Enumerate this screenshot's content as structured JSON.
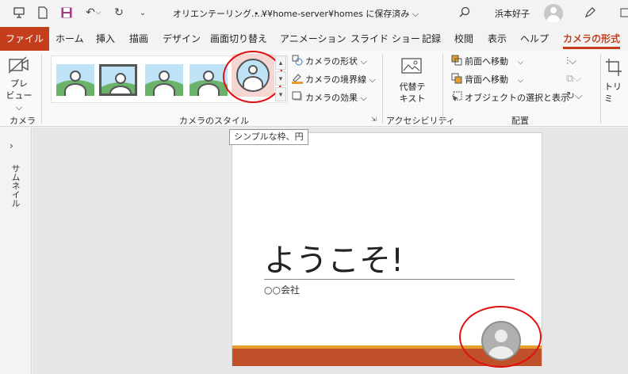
{
  "qat": {
    "doc_title": "オリエンテーリング.…",
    "save_status": "• ¥¥home-server¥homes に保存済み ⌵",
    "user_name": "浜本好子"
  },
  "tabs": [
    {
      "label": "ファイル"
    },
    {
      "label": "ホーム"
    },
    {
      "label": "挿入"
    },
    {
      "label": "描画"
    },
    {
      "label": "デザイン"
    },
    {
      "label": "画面切り替え"
    },
    {
      "label": "アニメーション"
    },
    {
      "label": "スライド ショー"
    },
    {
      "label": "記録"
    },
    {
      "label": "校閲"
    },
    {
      "label": "表示"
    },
    {
      "label": "ヘルプ"
    },
    {
      "label": "カメラの形式"
    }
  ],
  "ribbon": {
    "camera_group": {
      "preview_label": "プレ",
      "preview_label2": "ビュー ⌵",
      "group_label": "カメラ"
    },
    "style_group": {
      "group_label": "カメラのスタイル",
      "shape_label": "カメラの形状 ⌵",
      "border_label": "カメラの境界線 ⌵",
      "effect_label": "カメラの効果 ⌵"
    },
    "accessibility_group": {
      "alt_label1": "代替テ",
      "alt_label2": "キスト",
      "group_label": "アクセシビリティ"
    },
    "arrange_group": {
      "forward_label": "前面へ移動",
      "backward_label": "背面へ移動",
      "selection_label": "オブジェクトの選択と表示",
      "group_label": "配置"
    },
    "trim_label": "トリミ"
  },
  "tooltip": "シンプルな枠、円",
  "sidebar": {
    "label": "サムネイル"
  },
  "slide": {
    "title": "ようこそ!",
    "subtitle": "○○会社"
  },
  "colors": {
    "accent": "#c43e1c",
    "band_orange": "#e39e2b",
    "band_rust": "#c0502a",
    "highlight": "#f6d6d2",
    "annotation_red": "#e01010"
  }
}
